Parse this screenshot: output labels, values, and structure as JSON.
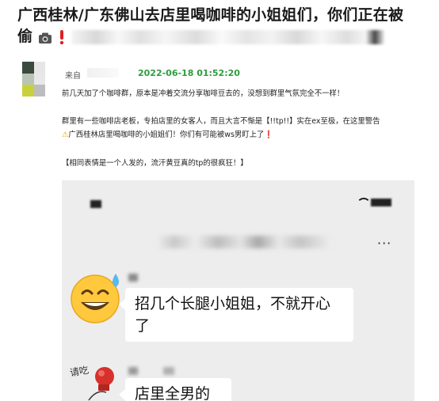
{
  "headline": {
    "line1": "广西桂林/广东佛山去店里喝咖啡的小姐姐们，你们正在被",
    "line2_visible": "偷",
    "icons": [
      "camera-icon",
      "exclamation-icon"
    ]
  },
  "post": {
    "from_label": "来自",
    "timestamp": "2022-06-18 01:52:20",
    "para1": "前几天加了个咖啡群，原本是冲着交流分享咖啡豆去的，没想到群里气氛完全不一样！",
    "para2_line1": "群里有一些咖啡店老板，专拍店里的女客人，而且大言不惭是【!!tp!!】实在ex至极，在这里警告",
    "para2_line2": "广西桂林店里喝咖啡的小姐姐们！你们有可能被ws男盯上了",
    "para3": "【相同表情是一个人发的，流汗黄豆真的tp的很疯狂！】"
  },
  "screenshot": {
    "more_icon": "···",
    "messages": [
      {
        "text_line1": "招几个长腿小姐姐，不就开心",
        "text_line2": "了",
        "avatar": "sweat-smile-emoji-icon"
      },
      {
        "text_line1": "店里全男的",
        "avatar": "boxing-sticker-icon",
        "sticker_text": "请吃"
      }
    ]
  },
  "colors": {
    "timestamp": "#2e9c3e",
    "alert_red": "#e02020",
    "warning": "#f0a500",
    "chat_bg": "#ededed",
    "bubble": "#ffffff"
  }
}
